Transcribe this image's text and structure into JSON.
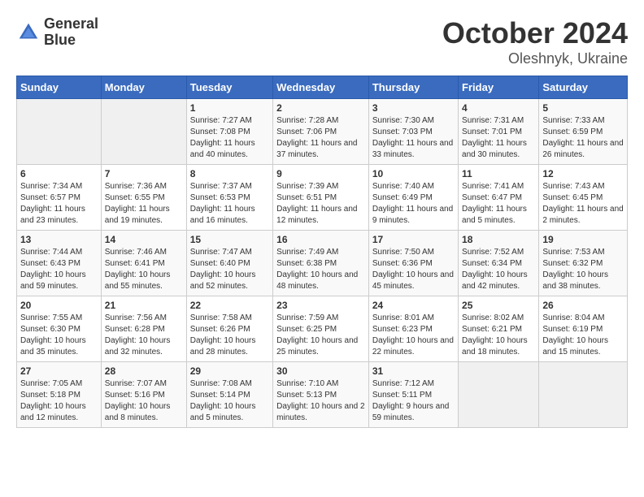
{
  "header": {
    "logo": {
      "line1": "General",
      "line2": "Blue"
    },
    "title": "October 2024",
    "subtitle": "Oleshnyk, Ukraine"
  },
  "weekdays": [
    "Sunday",
    "Monday",
    "Tuesday",
    "Wednesday",
    "Thursday",
    "Friday",
    "Saturday"
  ],
  "rows": [
    [
      {
        "day": "",
        "empty": true
      },
      {
        "day": "",
        "empty": true
      },
      {
        "day": "1",
        "sunrise": "7:27 AM",
        "sunset": "7:08 PM",
        "daylight": "11 hours and 40 minutes."
      },
      {
        "day": "2",
        "sunrise": "7:28 AM",
        "sunset": "7:06 PM",
        "daylight": "11 hours and 37 minutes."
      },
      {
        "day": "3",
        "sunrise": "7:30 AM",
        "sunset": "7:03 PM",
        "daylight": "11 hours and 33 minutes."
      },
      {
        "day": "4",
        "sunrise": "7:31 AM",
        "sunset": "7:01 PM",
        "daylight": "11 hours and 30 minutes."
      },
      {
        "day": "5",
        "sunrise": "7:33 AM",
        "sunset": "6:59 PM",
        "daylight": "11 hours and 26 minutes."
      }
    ],
    [
      {
        "day": "6",
        "sunrise": "7:34 AM",
        "sunset": "6:57 PM",
        "daylight": "11 hours and 23 minutes."
      },
      {
        "day": "7",
        "sunrise": "7:36 AM",
        "sunset": "6:55 PM",
        "daylight": "11 hours and 19 minutes."
      },
      {
        "day": "8",
        "sunrise": "7:37 AM",
        "sunset": "6:53 PM",
        "daylight": "11 hours and 16 minutes."
      },
      {
        "day": "9",
        "sunrise": "7:39 AM",
        "sunset": "6:51 PM",
        "daylight": "11 hours and 12 minutes."
      },
      {
        "day": "10",
        "sunrise": "7:40 AM",
        "sunset": "6:49 PM",
        "daylight": "11 hours and 9 minutes."
      },
      {
        "day": "11",
        "sunrise": "7:41 AM",
        "sunset": "6:47 PM",
        "daylight": "11 hours and 5 minutes."
      },
      {
        "day": "12",
        "sunrise": "7:43 AM",
        "sunset": "6:45 PM",
        "daylight": "11 hours and 2 minutes."
      }
    ],
    [
      {
        "day": "13",
        "sunrise": "7:44 AM",
        "sunset": "6:43 PM",
        "daylight": "10 hours and 59 minutes."
      },
      {
        "day": "14",
        "sunrise": "7:46 AM",
        "sunset": "6:41 PM",
        "daylight": "10 hours and 55 minutes."
      },
      {
        "day": "15",
        "sunrise": "7:47 AM",
        "sunset": "6:40 PM",
        "daylight": "10 hours and 52 minutes."
      },
      {
        "day": "16",
        "sunrise": "7:49 AM",
        "sunset": "6:38 PM",
        "daylight": "10 hours and 48 minutes."
      },
      {
        "day": "17",
        "sunrise": "7:50 AM",
        "sunset": "6:36 PM",
        "daylight": "10 hours and 45 minutes."
      },
      {
        "day": "18",
        "sunrise": "7:52 AM",
        "sunset": "6:34 PM",
        "daylight": "10 hours and 42 minutes."
      },
      {
        "day": "19",
        "sunrise": "7:53 AM",
        "sunset": "6:32 PM",
        "daylight": "10 hours and 38 minutes."
      }
    ],
    [
      {
        "day": "20",
        "sunrise": "7:55 AM",
        "sunset": "6:30 PM",
        "daylight": "10 hours and 35 minutes."
      },
      {
        "day": "21",
        "sunrise": "7:56 AM",
        "sunset": "6:28 PM",
        "daylight": "10 hours and 32 minutes."
      },
      {
        "day": "22",
        "sunrise": "7:58 AM",
        "sunset": "6:26 PM",
        "daylight": "10 hours and 28 minutes."
      },
      {
        "day": "23",
        "sunrise": "7:59 AM",
        "sunset": "6:25 PM",
        "daylight": "10 hours and 25 minutes."
      },
      {
        "day": "24",
        "sunrise": "8:01 AM",
        "sunset": "6:23 PM",
        "daylight": "10 hours and 22 minutes."
      },
      {
        "day": "25",
        "sunrise": "8:02 AM",
        "sunset": "6:21 PM",
        "daylight": "10 hours and 18 minutes."
      },
      {
        "day": "26",
        "sunrise": "8:04 AM",
        "sunset": "6:19 PM",
        "daylight": "10 hours and 15 minutes."
      }
    ],
    [
      {
        "day": "27",
        "sunrise": "7:05 AM",
        "sunset": "5:18 PM",
        "daylight": "10 hours and 12 minutes."
      },
      {
        "day": "28",
        "sunrise": "7:07 AM",
        "sunset": "5:16 PM",
        "daylight": "10 hours and 8 minutes."
      },
      {
        "day": "29",
        "sunrise": "7:08 AM",
        "sunset": "5:14 PM",
        "daylight": "10 hours and 5 minutes."
      },
      {
        "day": "30",
        "sunrise": "7:10 AM",
        "sunset": "5:13 PM",
        "daylight": "10 hours and 2 minutes."
      },
      {
        "day": "31",
        "sunrise": "7:12 AM",
        "sunset": "5:11 PM",
        "daylight": "9 hours and 59 minutes."
      },
      {
        "day": "",
        "empty": true
      },
      {
        "day": "",
        "empty": true
      }
    ]
  ]
}
